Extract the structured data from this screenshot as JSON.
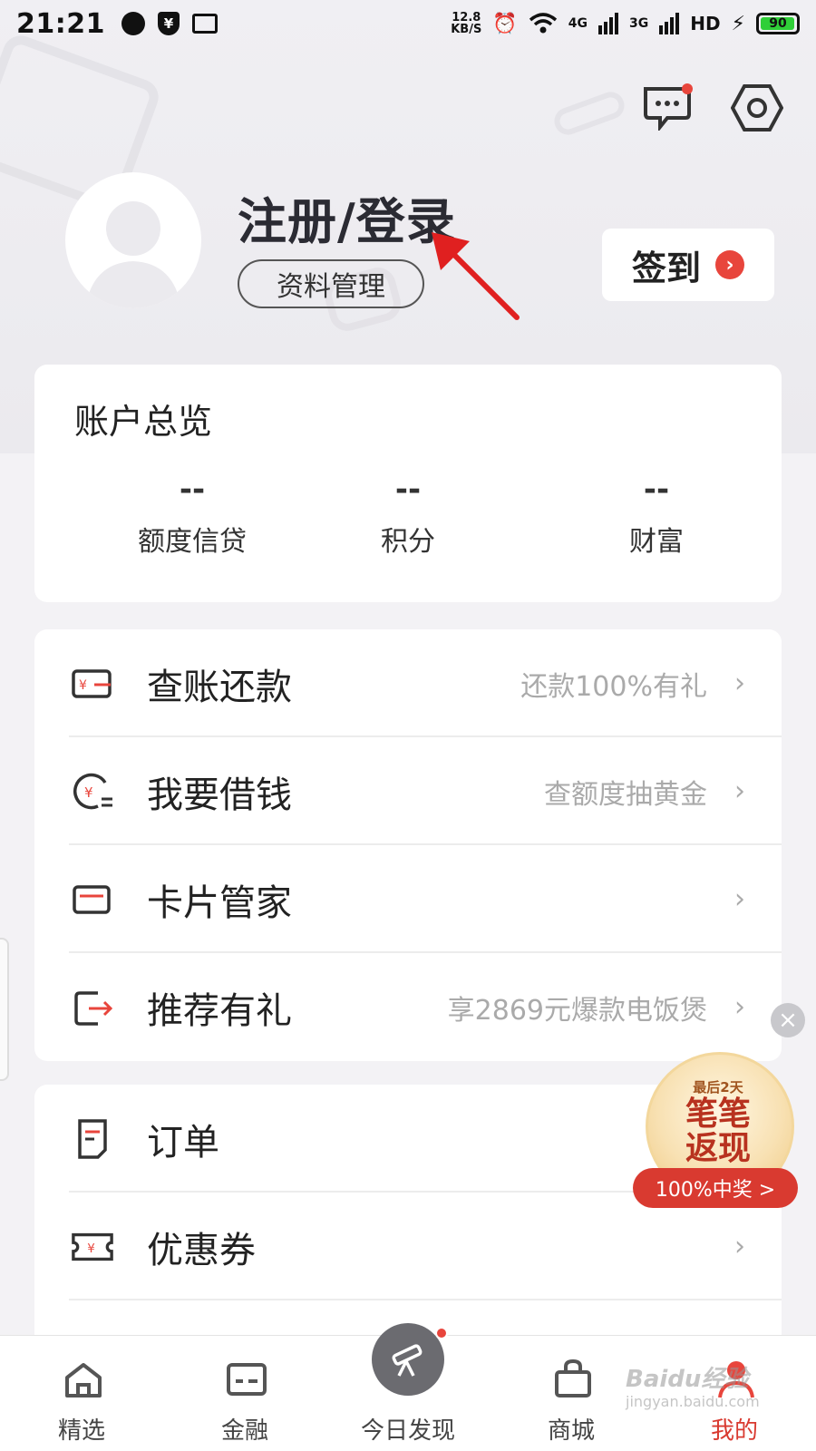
{
  "status_bar": {
    "time": "21:21",
    "speed_top": "12.8",
    "speed_bottom": "KB/S",
    "net1": "4G",
    "net2": "3G",
    "hd": "HD",
    "battery": "90"
  },
  "header": {
    "login_title": "注册/登录",
    "profile_button": "资料管理",
    "checkin_label": "签到"
  },
  "overview": {
    "title": "账户总览",
    "items": [
      {
        "value": "--",
        "label": "额度信贷"
      },
      {
        "value": "--",
        "label": "积分"
      },
      {
        "value": "--",
        "label": "财富"
      }
    ]
  },
  "menu": {
    "group1": [
      {
        "name": "查账还款",
        "hint": "还款100%有礼",
        "icon": "bill-repay-icon"
      },
      {
        "name": "我要借钱",
        "hint": "查额度抽黄金",
        "icon": "borrow-money-icon"
      },
      {
        "name": "卡片管家",
        "hint": "",
        "icon": "card-icon"
      },
      {
        "name": "推荐有礼",
        "hint": "享2869元爆款电饭煲",
        "icon": "share-exit-icon"
      }
    ],
    "group2": [
      {
        "name": "订单",
        "hint": "",
        "icon": "order-icon"
      },
      {
        "name": "优惠券",
        "hint": "",
        "icon": "coupon-icon"
      }
    ]
  },
  "promo": {
    "days": "最后2天",
    "line1": "笔笔",
    "line2": "返现",
    "pill": "100%中奖 >"
  },
  "bottom_nav": [
    {
      "label": "精选",
      "icon": "home-icon"
    },
    {
      "label": "金融",
      "icon": "finance-card-icon"
    },
    {
      "label": "今日发现",
      "icon": "telescope-icon"
    },
    {
      "label": "商城",
      "icon": "shopping-bag-icon"
    },
    {
      "label": "我的",
      "icon": "profile-icon"
    }
  ],
  "watermark": {
    "main": "Baidu经验",
    "sub": "jingyan.baidu.com"
  },
  "colors": {
    "accent": "#e8453c",
    "bg": "#f3f2f5"
  }
}
